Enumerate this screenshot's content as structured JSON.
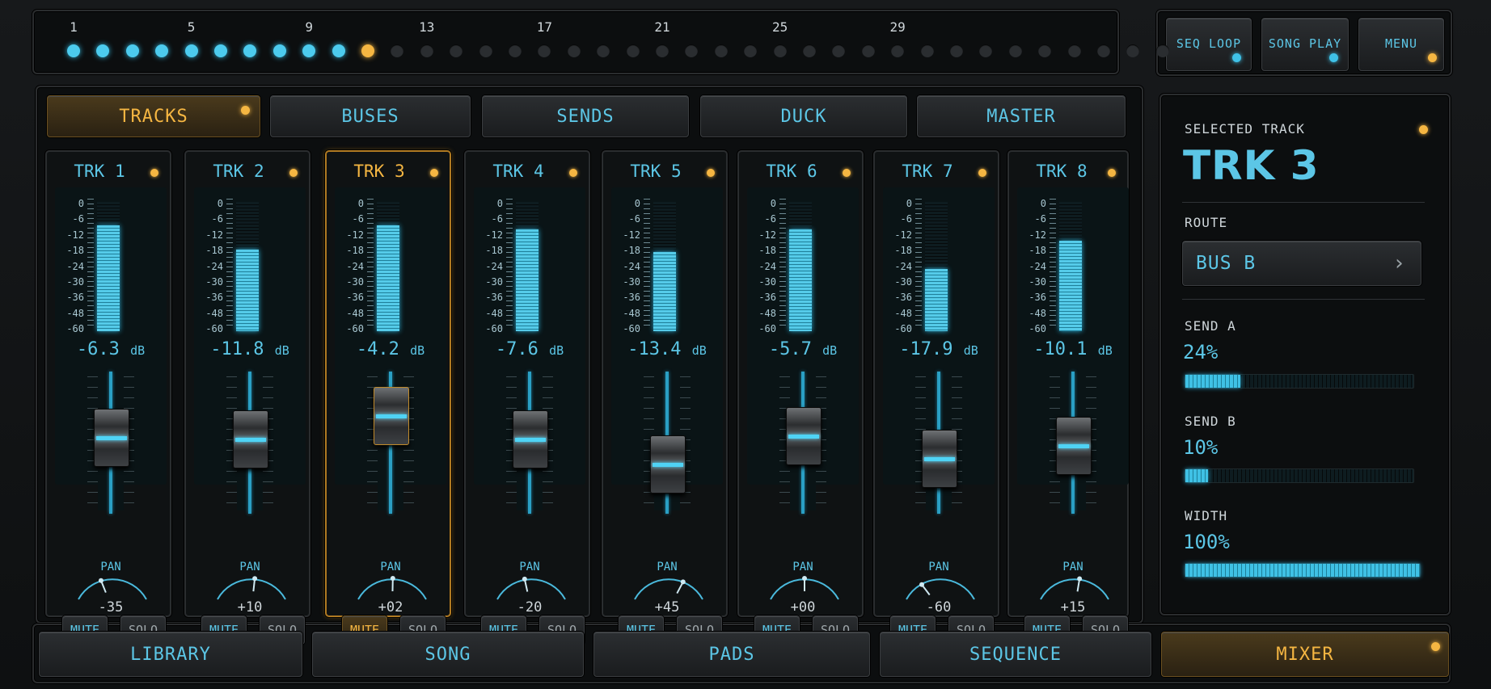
{
  "sequencer": {
    "labels": [
      "1",
      "5",
      "9",
      "13",
      "17",
      "21",
      "25",
      "29"
    ],
    "steps": [
      "lit",
      "lit",
      "lit",
      "lit",
      "lit",
      "lit",
      "lit",
      "lit",
      "lit",
      "lit",
      "cur",
      "off",
      "off",
      "off",
      "off",
      "off",
      "off",
      "off",
      "off",
      "off",
      "off",
      "off",
      "off",
      "off",
      "off",
      "off",
      "off",
      "off",
      "off",
      "off",
      "off",
      "off",
      "off",
      "off",
      "off",
      "off",
      "off",
      "off"
    ]
  },
  "transport": {
    "seq_loop": "SEQ LOOP",
    "song_play": "SONG PLAY",
    "menu": "MENU"
  },
  "tabs": [
    "TRACKS",
    "BUSES",
    "SENDS",
    "DUCK",
    "MASTER"
  ],
  "active_tab": "TRACKS",
  "scale": [
    "0",
    "-6",
    "-12",
    "-18",
    "-24",
    "-30",
    "-36",
    "-48",
    "-60"
  ],
  "labels": {
    "db": "dB",
    "pan": "PAN",
    "mute": "MUTE",
    "solo": "SOLO"
  },
  "tracks": [
    {
      "name": "TRK 1",
      "db": "-6.3",
      "meter": 0.82,
      "fader": 0.56,
      "pan_label": "-35",
      "pan": -0.35,
      "mute": false
    },
    {
      "name": "TRK 2",
      "db": "-11.8",
      "meter": 0.63,
      "fader": 0.54,
      "pan_label": "+10",
      "pan": 0.1,
      "mute": false
    },
    {
      "name": "TRK 3",
      "db": "-4.2",
      "meter": 0.82,
      "fader": 0.82,
      "pan_label": "+02",
      "pan": 0.02,
      "mute": true,
      "selected": true
    },
    {
      "name": "TRK 4",
      "db": "-7.6",
      "meter": 0.79,
      "fader": 0.54,
      "pan_label": "-20",
      "pan": -0.2,
      "mute": false
    },
    {
      "name": "TRK 5",
      "db": "-13.4",
      "meter": 0.61,
      "fader": 0.24,
      "pan_label": "+45",
      "pan": 0.45,
      "mute": false
    },
    {
      "name": "TRK 6",
      "db": "-5.7",
      "meter": 0.79,
      "fader": 0.58,
      "pan_label": "+00",
      "pan": 0.0,
      "mute": false
    },
    {
      "name": "TRK 7",
      "db": "-17.9",
      "meter": 0.48,
      "fader": 0.31,
      "pan_label": "-60",
      "pan": -0.6,
      "mute": false
    },
    {
      "name": "TRK 8",
      "db": "-10.1",
      "meter": 0.7,
      "fader": 0.46,
      "pan_label": "+15",
      "pan": 0.15,
      "mute": false
    }
  ],
  "selected_panel": {
    "heading": "SELECTED TRACK",
    "track": "TRK 3",
    "route_label": "ROUTE",
    "route_value": "BUS B",
    "send_a_label": "SEND A",
    "send_a_value": "24%",
    "send_a": 0.24,
    "send_b_label": "SEND B",
    "send_b_value": "10%",
    "send_b": 0.1,
    "width_label": "WIDTH",
    "width_value": "100%",
    "width": 1.0
  },
  "bottom_nav": [
    "LIBRARY",
    "SONG",
    "PADS",
    "SEQUENCE",
    "MIXER"
  ],
  "active_nav": "MIXER",
  "colors": {
    "accent": "#f5b642",
    "meter": "#4ccbee",
    "text": "#5cc6e6"
  }
}
